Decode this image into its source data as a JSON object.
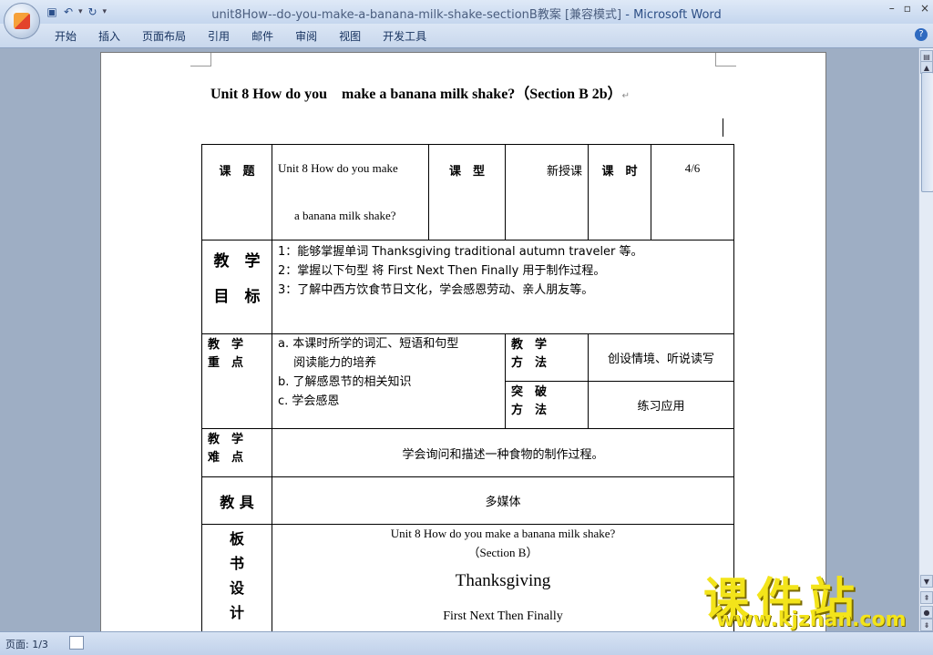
{
  "window": {
    "title": "unit8How--do-you-make-a-banana-milk-shake-sectionB教案 [兼容模式]",
    "app_suffix": " - Microsoft Word",
    "controls": [
      "–",
      "▫",
      "×"
    ]
  },
  "quick_access": {
    "save_icon": "save-icon",
    "undo_icon": "undo-icon",
    "redo_icon": "redo-icon",
    "customize_icon": "customize-icon"
  },
  "ribbon": {
    "tabs": [
      "开始",
      "插入",
      "页面布局",
      "引用",
      "邮件",
      "审阅",
      "视图",
      "开发工具"
    ],
    "help_label": "?"
  },
  "document": {
    "title": "Unit 8 How do you    make a banana milk shake?（Section B 2b）",
    "para_mark": "↵",
    "table": {
      "r1": {
        "topic_label": "课　题",
        "topic_value_1": "Unit 8 How do you    make",
        "topic_value_2": "a banana milk shake?",
        "type_label": "课　型",
        "type_value": "新授课",
        "hours_label": "课　时",
        "hours_value": "4/6"
      },
      "r2": {
        "label_1": "教　学",
        "label_2": "目　标",
        "items": [
          "1：能够掌握单词 Thanksgiving traditional autumn traveler  等。",
          "2：掌握以下句型  将 First Next Then Finally 用于制作过程。",
          "3：了解中西方饮食节日文化，学会感恩劳动、亲人朋友等。"
        ]
      },
      "r3": {
        "label_1": "教　学",
        "label_2": "重　点",
        "items": [
          "a. 本课时所学的词汇、短语和句型",
          "　 阅读能力的培养",
          "b. 了解感恩节的相关知识",
          "c. 学会感恩"
        ],
        "method_label_1": "教　学",
        "method_label_2": "方　法",
        "method_value": "创设情境、听说读写",
        "break_label_1": "突　破",
        "break_label_2": "方　法",
        "break_value": "练习应用"
      },
      "r4": {
        "label_1": "教　学",
        "label_2": "难　点",
        "value": "学会询问和描述一种食物的制作过程。"
      },
      "r5": {
        "label": "教 具",
        "value": "多媒体"
      },
      "r6": {
        "label_chars": [
          "板",
          "书",
          "设",
          "计"
        ],
        "line1": "Unit 8 How do you    make a banana milk shake?",
        "line2": "（Section B）",
        "line3": "Thanksgiving",
        "line4": "First Next Then Finally"
      }
    }
  },
  "status": {
    "page": "页面: 1/3"
  },
  "watermark": {
    "main": "课件站",
    "url": "www.kjzhan.com"
  }
}
